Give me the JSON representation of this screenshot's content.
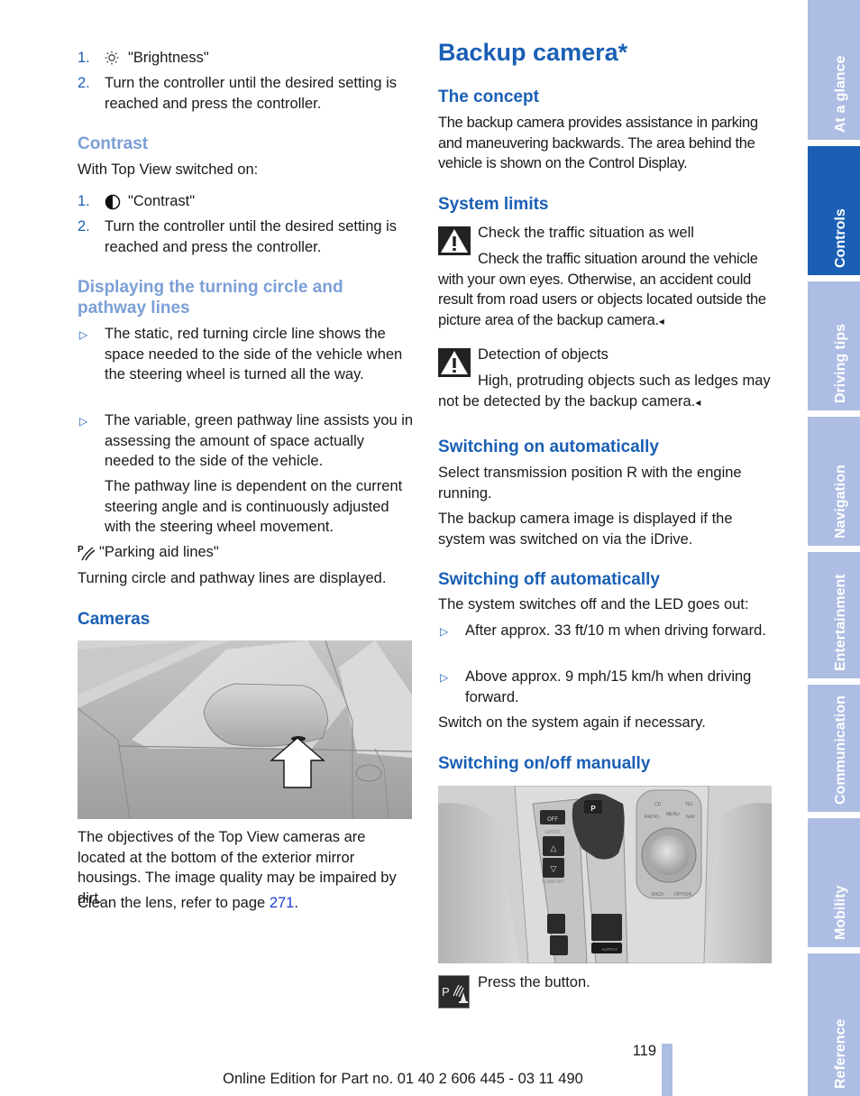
{
  "left_column": {
    "brightness_steps": [
      {
        "num": "1.",
        "icon": "brightness-sun-icon",
        "text": "\"Brightness\""
      },
      {
        "num": "2.",
        "text": "Turn the controller until the desired setting is reached and press the controller."
      }
    ],
    "contrast": {
      "heading": "Contrast",
      "intro": "With Top View switched on:",
      "steps": [
        {
          "num": "1.",
          "icon": "contrast-half-circle-icon",
          "text": "\"Contrast\""
        },
        {
          "num": "2.",
          "text": "Turn the controller until the desired setting is reached and press the controller."
        }
      ]
    },
    "turning_circle": {
      "heading": "Displaying the turning circle and pathway lines",
      "bullets": [
        {
          "text": "The static, red turning circle line shows the space needed to the side of the vehicle when the steering wheel is turned all the way."
        },
        {
          "text": "The variable, green pathway line assists you in assessing the amount of space actually needed to the side of the vehicle.",
          "subtext": "The pathway line is dependent on the current steering angle and is continuously adjusted with the steering wheel movement."
        }
      ],
      "menu_item": {
        "icon": "parking-aid-lines-icon",
        "text": "\"Parking aid lines\""
      },
      "result": "Turning circle and pathway lines are displayed."
    },
    "cameras": {
      "heading": "Cameras",
      "image": "exterior-mirror-camera-illustration",
      "text": "The objectives of the Top View cameras are located at the bottom of the exterior mirror housings. The image quality may be impaired by dirt.",
      "clean_prefix": "Clean the lens, refer to page ",
      "clean_link": "271",
      "clean_suffix": "."
    }
  },
  "right_column": {
    "title": "Backup camera*",
    "concept": {
      "heading": "The concept",
      "text": "The backup camera provides assistance in parking and maneuvering backwards. The area behind the vehicle is shown on the Control Display."
    },
    "system_limits": {
      "heading": "System limits",
      "warnings": [
        {
          "title": "Check the traffic situation as well",
          "text": "Check the traffic situation around the vehicle with your own eyes. Otherwise, an accident could result from road users or objects located outside the picture area of the backup camera.",
          "end": "◂"
        },
        {
          "title": "Detection of objects",
          "text": "High, protruding objects such as ledges may not be detected by the backup camera.",
          "end": "◂"
        }
      ]
    },
    "switch_on_auto": {
      "heading": "Switching on automatically",
      "p1": "Select transmission position R with the engine running.",
      "p2": "The backup camera image is displayed if the system was switched on via the iDrive."
    },
    "switch_off_auto": {
      "heading": "Switching off automatically",
      "intro": "The system switches off and the LED goes out:",
      "bullets": [
        "After approx. 33 ft/10 m when driving forward.",
        "Above approx. 9 mph/15 km/h when driving forward."
      ],
      "outro": "Switch on the system again if necessary."
    },
    "manual": {
      "heading": "Switching on/off manually",
      "image": "center-console-controls-illustration",
      "console_labels": {
        "gear": "P",
        "off": "OFF",
        "sport": "SPORT",
        "comfort": "COMFORT",
        "cd": "CD",
        "menu": "MENU",
        "tel": "TEL",
        "radio": "RADIO",
        "nav": "NAV",
        "back": "BACK",
        "option": "OPTION",
        "auto": "AUTO H"
      },
      "button_icon": "pdc-button-icon",
      "button_icon_label": "P",
      "instruction": "Press the button."
    }
  },
  "side_tabs": [
    {
      "label": "At a glance",
      "active": false
    },
    {
      "label": "Controls",
      "active": true
    },
    {
      "label": "Driving tips",
      "active": false
    },
    {
      "label": "Navigation",
      "active": false
    },
    {
      "label": "Entertainment",
      "active": false
    },
    {
      "label": "Communication",
      "active": false
    },
    {
      "label": "Mobility",
      "active": false
    },
    {
      "label": "Reference",
      "active": false
    }
  ],
  "footer": {
    "page_number": "119",
    "edition": "Online Edition for Part no. 01 40 2 606 445 - 03 11 490"
  },
  "colors": {
    "heading_blue": "#1a5fb4",
    "heading_light_blue": "#7b9fd6",
    "tab_inactive": "#adbde3",
    "tab_active": "#1a5fb4",
    "link_blue": "#1a3fd6"
  }
}
